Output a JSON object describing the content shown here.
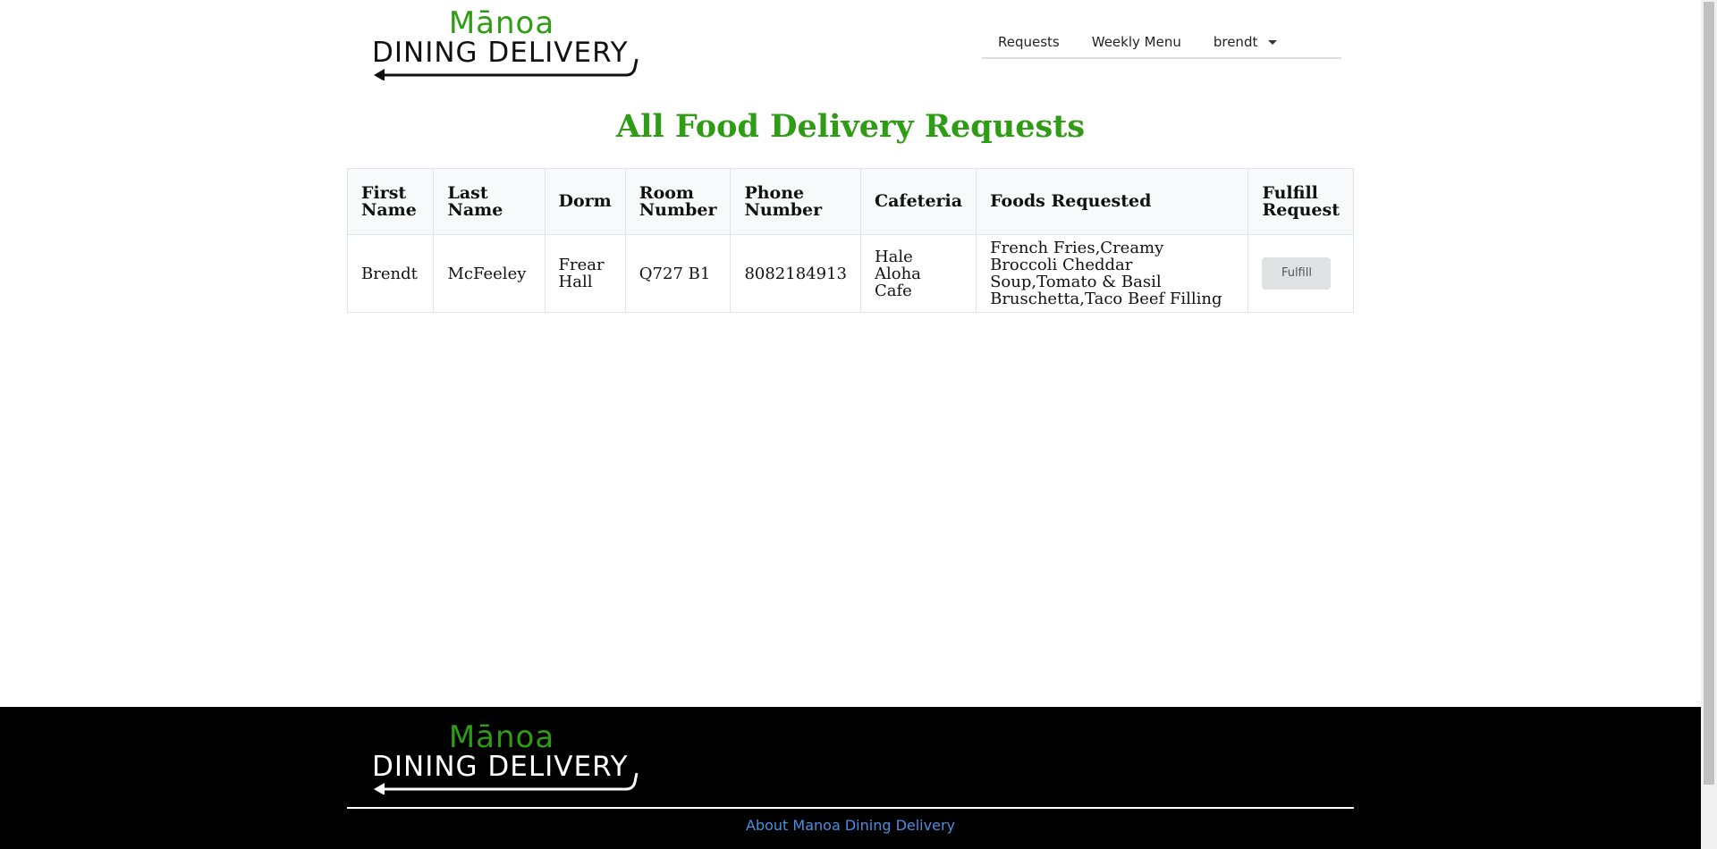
{
  "brand": {
    "logo_top": "Mānoa",
    "logo_bottom": "DINING DELIVERY",
    "primary_color": "#2e9c14"
  },
  "nav": {
    "items": [
      {
        "label": "Requests"
      },
      {
        "label": "Weekly Menu"
      }
    ],
    "user": "brendt"
  },
  "page": {
    "title": "All Food Delivery Requests"
  },
  "table": {
    "headers": [
      "First Name",
      "Last Name",
      "Dorm",
      "Room Number",
      "Phone Number",
      "Cafeteria",
      "Foods Requested",
      "Fulfill Request"
    ],
    "rows": [
      {
        "first_name": "Brendt",
        "last_name": "McFeeley",
        "dorm": "Frear Hall",
        "room": "Q727 B1",
        "phone": "8082184913",
        "cafeteria": "Hale Aloha Cafe",
        "foods": "French Fries,Creamy Broccoli Cheddar Soup,Tomato & Basil Bruschetta,Taco Beef Filling",
        "action_label": "Fulfill"
      }
    ]
  },
  "footer": {
    "logo_top": "Mānoa",
    "logo_bottom": "DINING DELIVERY",
    "link": "About Manoa Dining Delivery"
  }
}
